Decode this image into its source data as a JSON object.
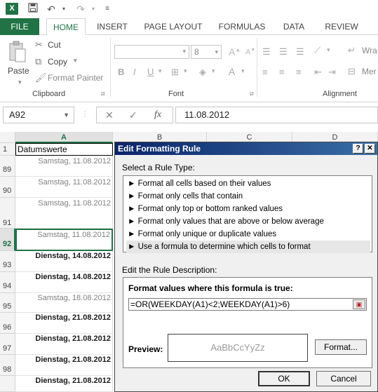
{
  "titlebar": {
    "app_icon": "X",
    "icons": [
      "save-icon",
      "undo-icon",
      "undo-dropdown-icon",
      "redo-icon",
      "redo-dropdown-icon",
      "customize-icon"
    ]
  },
  "ribbon": {
    "tabs": [
      "FILE",
      "HOME",
      "INSERT",
      "PAGE LAYOUT",
      "FORMULAS",
      "DATA",
      "REVIEW"
    ],
    "active_tab": "HOME",
    "clipboard": {
      "paste": "Paste",
      "cut": "Cut",
      "copy": "Copy",
      "format_painter": "Format Painter",
      "label": "Clipboard"
    },
    "font": {
      "font_size": "8",
      "label": "Font"
    },
    "alignment": {
      "wrap": "Wra",
      "merge": "Mer",
      "label": "Alignment"
    }
  },
  "formula_bar": {
    "name_box": "A92",
    "cancel": "✕",
    "enter": "✓",
    "fx": "fx",
    "value": "11.08.2012"
  },
  "grid": {
    "columns": [
      "A",
      "B",
      "C",
      "D"
    ],
    "header_row": {
      "row": "1",
      "value": "Datumswerte"
    },
    "rows": [
      {
        "row": "89",
        "value": "Samstag, 11.08.2012",
        "style": "grey"
      },
      {
        "row": "90",
        "value": "Samstag, 11.08.2012",
        "style": "grey"
      },
      {
        "row": "91",
        "value": "Samstag, 11.08.2012",
        "style": "grey"
      },
      {
        "row": "92",
        "value": "Samstag, 11.08.2012",
        "style": "grey"
      },
      {
        "row": "93",
        "value": "Dienstag, 14.08.2012",
        "style": "bold"
      },
      {
        "row": "94",
        "value": "Dienstag, 14.08.2012",
        "style": "bold"
      },
      {
        "row": "95",
        "value": "Samstag, 18.08.2012",
        "style": "grey"
      },
      {
        "row": "96",
        "value": "Dienstag, 21.08.2012",
        "style": "bold"
      },
      {
        "row": "97",
        "value": "Dienstag, 21.08.2012",
        "style": "bold"
      },
      {
        "row": "98",
        "value": "Dienstag, 21.08.2012",
        "style": "bold"
      },
      {
        "row": "",
        "value": "Dienstag, 21.08.2012",
        "style": "bold"
      }
    ]
  },
  "dialog": {
    "title": "Edit Formatting Rule",
    "help": "?",
    "close": "✕",
    "select_type_label": "Select a Rule Type:",
    "rule_types": [
      "► Format all cells based on their values",
      "► Format only cells that contain",
      "► Format only top or bottom ranked values",
      "► Format only values that are above or below average",
      "► Format only unique or duplicate values",
      "► Use a formula to determine which cells to format"
    ],
    "selected_rule_index": 5,
    "edit_desc_label": "Edit the Rule Description:",
    "formula_heading": "Format values where this formula is true:",
    "formula": "=OR(WEEKDAY(A1)<2;WEEKDAY(A1)>6)",
    "preview_label": "Preview:",
    "preview_text": "AaBbCcYyZz",
    "format_button": "Format...",
    "ok": "OK",
    "cancel": "Cancel"
  }
}
